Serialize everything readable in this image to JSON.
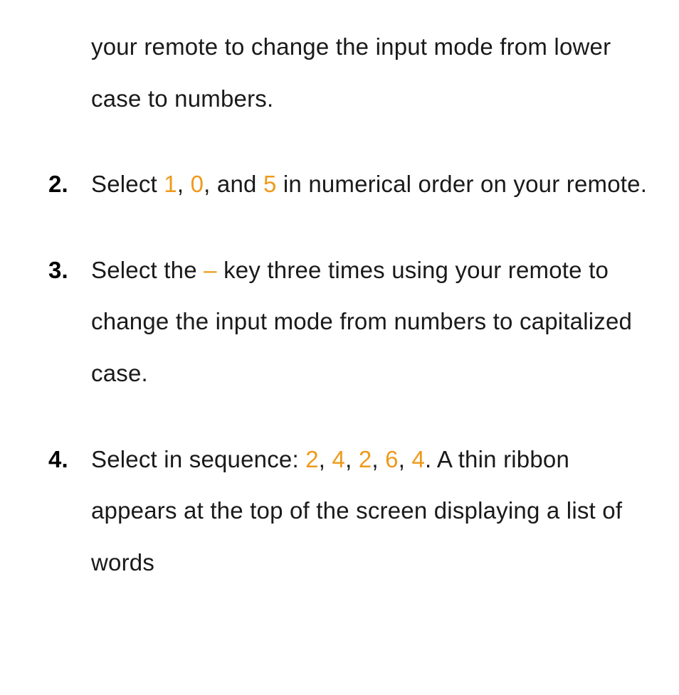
{
  "continued_line": "your remote to change the input mode from lower case to numbers.",
  "steps": [
    {
      "number": "2.",
      "parts": [
        {
          "kind": "text",
          "t": "Select "
        },
        {
          "kind": "num",
          "t": "1"
        },
        {
          "kind": "text",
          "t": ", "
        },
        {
          "kind": "num",
          "t": "0"
        },
        {
          "kind": "text",
          "t": ", and "
        },
        {
          "kind": "num",
          "t": "5"
        },
        {
          "kind": "text",
          "t": " in numerical order on your remote."
        }
      ]
    },
    {
      "number": "3.",
      "parts": [
        {
          "kind": "text",
          "t": "Select the "
        },
        {
          "kind": "dash",
          "t": "–"
        },
        {
          "kind": "text",
          "t": " key three times using your remote to change the input mode from numbers to capitalized case."
        }
      ]
    },
    {
      "number": "4.",
      "parts": [
        {
          "kind": "text",
          "t": "Select in sequence: "
        },
        {
          "kind": "num",
          "t": "2"
        },
        {
          "kind": "text",
          "t": ", "
        },
        {
          "kind": "num",
          "t": "4"
        },
        {
          "kind": "text",
          "t": ", "
        },
        {
          "kind": "num",
          "t": "2"
        },
        {
          "kind": "text",
          "t": ", "
        },
        {
          "kind": "num",
          "t": "6"
        },
        {
          "kind": "text",
          "t": ", "
        },
        {
          "kind": "num",
          "t": "4"
        },
        {
          "kind": "text",
          "t": ". A thin ribbon appears at the top of the screen displaying a list of words"
        }
      ]
    }
  ]
}
